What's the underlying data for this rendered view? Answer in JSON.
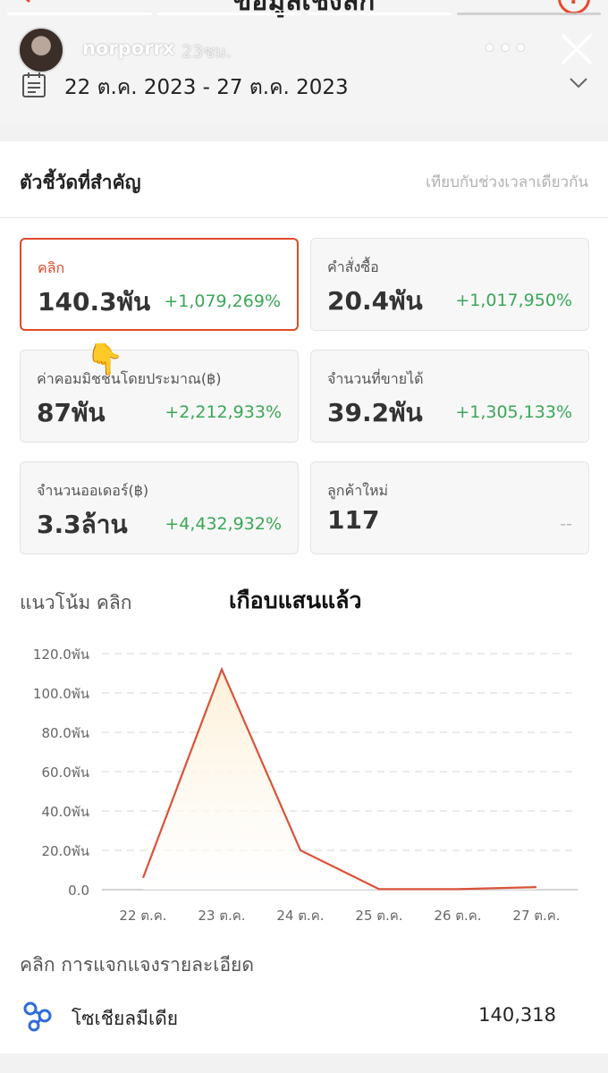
{
  "header": {
    "title": "ข้อมูลเชิงลึก",
    "help": "?"
  },
  "story": {
    "username": "norporrx",
    "time_ago": "23ชม.",
    "more": "•••"
  },
  "date_range": "22 ต.ค. 2023 - 27 ต.ค. 2023",
  "key_metrics": {
    "title": "ตัวชี้วัดที่สำคัญ",
    "compare_label": "เทียบกับช่วงเวลาเดียวกัน",
    "cards": [
      {
        "label": "คลิก",
        "value": "140.3พัน",
        "delta": "+1,079,269%",
        "selected": true
      },
      {
        "label": "คำสั่งซื้อ",
        "value": "20.4พัน",
        "delta": "+1,017,950%"
      },
      {
        "label": "ค่าคอมมิชชันโดยประมาณ(฿)",
        "value": "87พัน",
        "delta": "+2,212,933%"
      },
      {
        "label": "จำนวนที่ขายได้",
        "value": "39.2พัน",
        "delta": "+1,305,133%"
      },
      {
        "label": "จำนวนออเดอร์(฿)",
        "value": "3.3ล้าน",
        "delta": "+4,432,932%"
      },
      {
        "label": "ลูกค้าใหม่",
        "value": "117",
        "delta": "--"
      }
    ]
  },
  "pointer_emoji": "👇",
  "trend": {
    "title": "แนวโน้ม คลิก",
    "caption": "เกือบแสนแล้ว"
  },
  "chart_data": {
    "type": "area",
    "categories": [
      "22 ต.ค.",
      "23 ต.ค.",
      "24 ต.ค.",
      "25 ต.ค.",
      "26 ต.ค.",
      "27 ต.ค."
    ],
    "series": [
      {
        "values": [
          6000,
          112000,
          20000,
          300,
          300,
          1300
        ]
      }
    ],
    "yticks": [
      "0.0",
      "20.0พัน",
      "40.0พัน",
      "60.0พัน",
      "80.0พัน",
      "100.0พัน",
      "120.0พัน"
    ],
    "ylim": [
      0,
      120000
    ],
    "grid": true,
    "line_color": "#d9533a",
    "fill_color": "#fdf0d8"
  },
  "breakdown": {
    "title": "คลิก การแจกแจงรายละเอียด",
    "rows": [
      {
        "label": "โซเชียลมีเดีย",
        "value": "140,318",
        "icon": "share-network-icon"
      }
    ]
  },
  "colors": {
    "accent": "#e04a2c",
    "positive": "#3aa757"
  }
}
